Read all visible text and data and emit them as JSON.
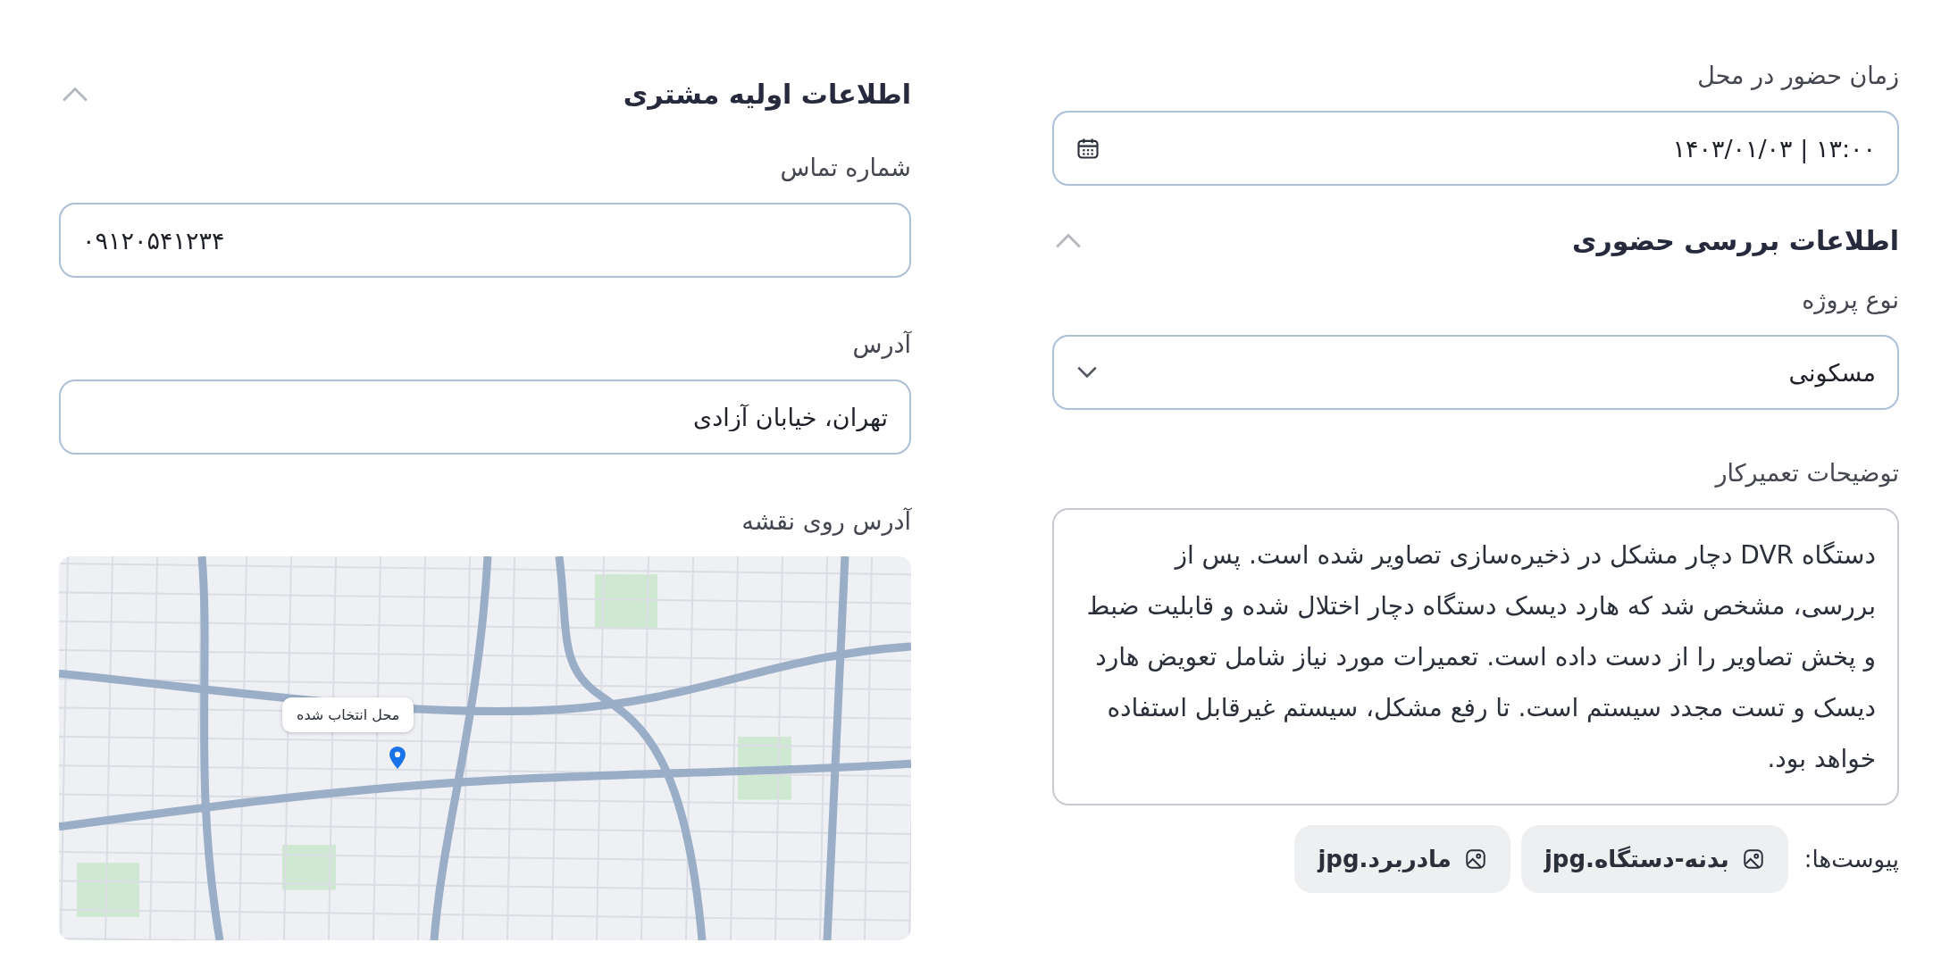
{
  "visit": {
    "time_label": "زمان حضور در محل",
    "time_value": "۱۳:۰۰ | ۱۴۰۳/۰۱/۰۳"
  },
  "inspection": {
    "title": "اطلاعات بررسی حضوری",
    "expanded": true,
    "project_type": {
      "label": "نوع پروژه",
      "value": "مسکونی"
    },
    "description": {
      "label": "توضیحات تعمیرکار",
      "value": "دستگاه DVR دچار مشکل در ذخیره‌سازی تصاویر شده است. پس از بررسی، مشخص شد که هارد دیسک دستگاه دچار اختلال شده و قابلیت ضبط و پخش تصاویر را از دست داده است. تعمیرات مورد نیاز شامل تعویض هارد دیسک و تست مجدد سیستم است. تا رفع مشکل، سیستم غیرقابل استفاده خواهد بود."
    },
    "attachments_label": "پیوست‌ها:",
    "attachments": [
      "بدنه-دستگاه.jpg",
      "مادربرد.jpg"
    ]
  },
  "customer": {
    "title": "اطلاعات اولیه مشتری",
    "expanded": true,
    "phone": {
      "label": "شماره تماس",
      "value": "۰۹۱۲۰۵۴۱۲۳۴"
    },
    "address": {
      "label": "آدرس",
      "value": "تهران، خیابان آزادی"
    },
    "map": {
      "label": "آدرس روی نقشه",
      "kind": "picture",
      "popup": "محل انتخاب شده"
    }
  }
}
